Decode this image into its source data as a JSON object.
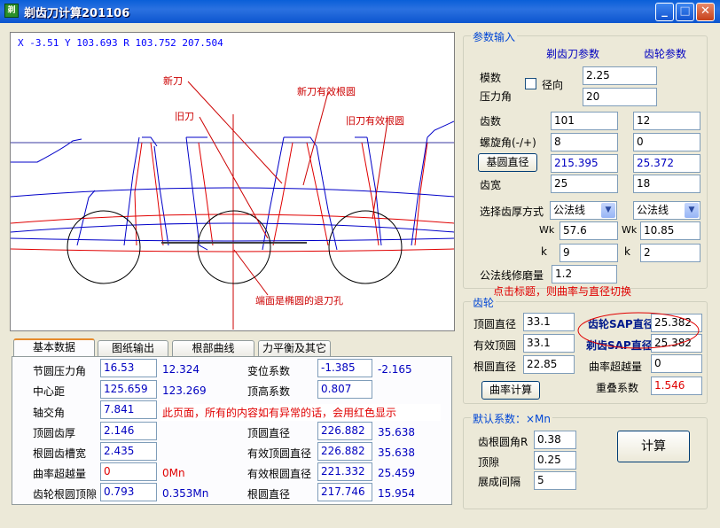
{
  "window": {
    "title": "剃齿刀计算201106",
    "icon_text": "剃",
    "min": "_",
    "max": "□",
    "close": "✕"
  },
  "canvas": {
    "coord_text": "X -3.51  Y 103.693 R 103.752  207.504",
    "annotations": {
      "new_cutter": "新刀",
      "old_cutter": "旧刀",
      "new_root": "新刀有效根圆",
      "old_root": "旧刀有效根圆",
      "relief": "端面是椭圆的退刀孔"
    }
  },
  "params": {
    "legend": "参数输入",
    "col_cutter": "剃齿刀参数",
    "col_gear": "齿轮参数",
    "module_label": "模数",
    "module": "2.25",
    "radial_label": "径向",
    "pressure_label": "压力角",
    "pressure": "20",
    "teeth_label": "齿数",
    "teeth_cutter": "101",
    "teeth_gear": "12",
    "helix_label": "螺旋角(-/+)",
    "helix_cutter": "8",
    "helix_gear": "0",
    "base_btn": "基圆直径",
    "base_cutter": "215.395",
    "base_gear": "25.372",
    "width_label": "齿宽",
    "width_cutter": "25",
    "width_gear": "18",
    "thick_label": "选择齿厚方式",
    "thick_cutter": "公法线",
    "thick_gear": "公法线",
    "wk_label": "Wk",
    "wk_cutter": "57.6",
    "wk_gear": "10.85",
    "k_label": "k",
    "k_cutter": "9",
    "k_gear": "2",
    "grind_label": "公法线修磨量",
    "grind": "1.2"
  },
  "hint": "点击标题，则曲率与直径切换",
  "gear": {
    "legend": "齿轮",
    "tip_label": "顶圆直径",
    "tip": "33.1",
    "eff_tip_label": "有效顶圆",
    "eff_tip": "33.1",
    "root_label": "根圆直径",
    "root": "22.85",
    "sap_gear_label": "齿轮SAP直径",
    "sap_gear": "25.382",
    "sap_cutter_label": "剃齿SAP直径",
    "sap_cutter": "25.382",
    "over_label": "曲率超越量",
    "over": "0",
    "overlap_label": "重叠系数",
    "overlap": "1.546",
    "curv_btn": "曲率计算"
  },
  "defaults": {
    "legend": "默认系数：×Mn",
    "fillet_label": "齿根圆角R",
    "fillet": "0.38",
    "clear_label": "顶隙",
    "clear": "0.25",
    "exp_label": "展成间隔",
    "exp": "5"
  },
  "calc_btn": "计算",
  "tabs": [
    "基本数据",
    "图纸输出",
    "根部曲线",
    "力平衡及其它"
  ],
  "basic": {
    "pitch_pa_label": "节圆压力角",
    "pitch_pa": "16.53",
    "pitch_pa2": "12.324",
    "shift_label": "变位系数",
    "shift": "-1.385",
    "shift2": "-2.165",
    "center_label": "中心距",
    "center": "125.659",
    "center2": "123.269",
    "addendum_label": "顶高系数",
    "addendum": "0.807",
    "cross_label": "轴交角",
    "cross": "7.841",
    "warn": "此页面，所有的内容如有异常的话，会用红色显示",
    "tip_thick_label": "顶圆齿厚",
    "tip_thick": "2.146",
    "tip_dia_label": "顶圆直径",
    "tip_dia": "226.882",
    "tip_dia2": "35.638",
    "root_slot_label": "根圆齿槽宽",
    "root_slot": "2.435",
    "eff_tip_label": "有效顶圆直径",
    "eff_tip": "226.882",
    "eff_tip2": "35.638",
    "over_label": "曲率超越量",
    "over": "0",
    "over2": "0Mn",
    "eff_root_label": "有效根圆直径",
    "eff_root": "221.332",
    "eff_root2": "25.459",
    "gap_label": "齿轮根圆顶隙",
    "gap": "0.793",
    "gap2": "0.353Mn",
    "root_dia_label": "根圆直径",
    "root_dia": "217.746",
    "root_dia2": "15.954"
  }
}
